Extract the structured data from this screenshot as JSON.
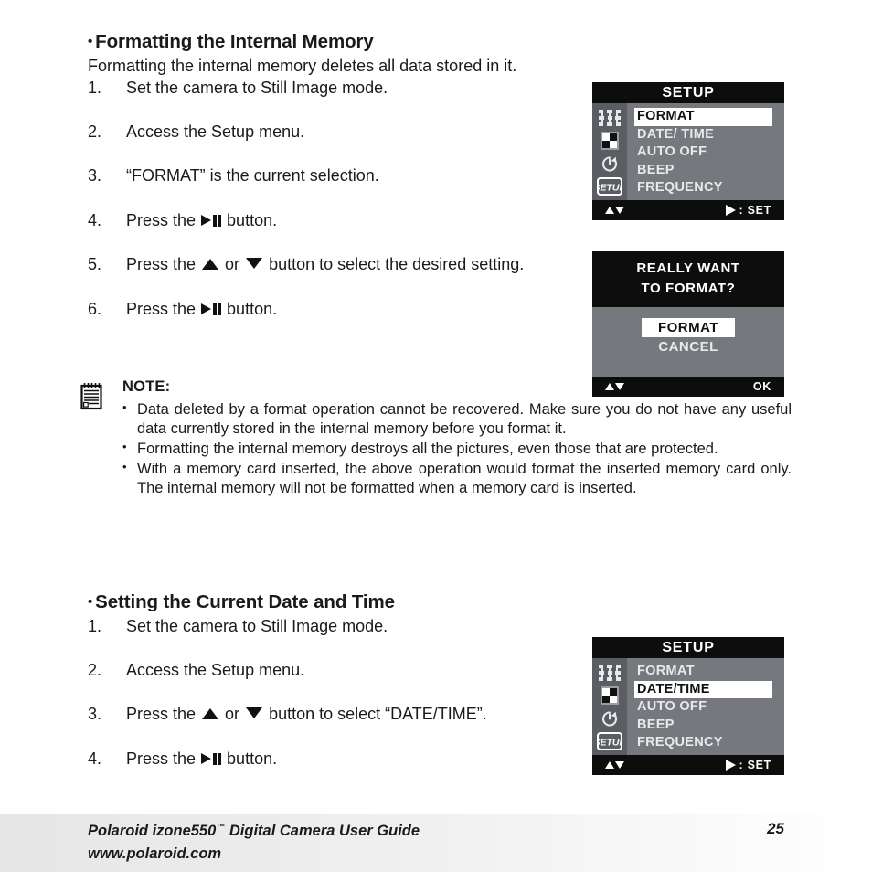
{
  "sections": [
    {
      "heading": "Formatting the Internal Memory",
      "intro": "Formatting the internal memory deletes all data stored in it.",
      "steps": [
        {
          "num": "1.",
          "pre": "Set the camera to Still Image mode.",
          "post": ""
        },
        {
          "num": "2.",
          "pre": "Access the Setup menu.",
          "post": ""
        },
        {
          "num": "3.",
          "pre": "“FORMAT” is the current selection.",
          "post": ""
        },
        {
          "num": "4.",
          "pre": "Press the ",
          "post": " button."
        },
        {
          "num": "5.",
          "pre": "Press the ",
          "post": " button to select the desired setting."
        },
        {
          "num": "6.",
          "pre": "Press the ",
          "post": " button."
        }
      ]
    },
    {
      "heading": "Setting the Current Date and Time",
      "steps": [
        {
          "num": "1.",
          "pre": "Set the camera to Still Image mode.",
          "post": ""
        },
        {
          "num": "2.",
          "pre": "Access the Setup menu.",
          "post": ""
        },
        {
          "num": "3.",
          "pre": "Press the ",
          "post": " button to select “DATE/TIME”."
        },
        {
          "num": "4.",
          "pre": "Press the ",
          "post": " button."
        }
      ]
    }
  ],
  "step5_mid": " or ",
  "note": {
    "heading": "NOTE:",
    "bullet_glyph": "•",
    "items": [
      "Data deleted by a format operation cannot be recovered. Make sure you do not have any useful data currently stored in the internal memory before you format it.",
      "Formatting the internal memory destroys all the pictures, even those that are protected.",
      "With a memory card inserted, the above operation would format the inserted memory card only. The internal memory will not be formatted when a memory card is inserted."
    ]
  },
  "lcd_setup_1": {
    "title": "SETUP",
    "menu": [
      {
        "label": "FORMAT",
        "selected": true
      },
      {
        "label": "DATE/ TIME",
        "selected": false
      },
      {
        "label": "AUTO OFF",
        "selected": false
      },
      {
        "label": "BEEP",
        "selected": false
      },
      {
        "label": "FREQUENCY",
        "selected": false
      }
    ],
    "sidebar_icons": [
      "resolution-icon",
      "quality-icon",
      "self-timer-icon",
      "setup-icon"
    ],
    "setup_icon_label": "SETUP",
    "footer_right": ": SET"
  },
  "lcd_confirm": {
    "line1": "REALLY WANT",
    "line2": "TO FORMAT?",
    "options": [
      {
        "label": "FORMAT",
        "selected": true
      },
      {
        "label": "CANCEL",
        "selected": false
      }
    ],
    "footer_right": "OK"
  },
  "lcd_setup_2": {
    "title": "SETUP",
    "menu": [
      {
        "label": "FORMAT",
        "selected": false
      },
      {
        "label": "DATE/TIME",
        "selected": true
      },
      {
        "label": "AUTO OFF",
        "selected": false
      },
      {
        "label": "BEEP",
        "selected": false
      },
      {
        "label": "FREQUENCY",
        "selected": false
      }
    ],
    "sidebar_icons": [
      "resolution-icon",
      "quality-icon",
      "self-timer-icon",
      "setup-icon"
    ],
    "setup_icon_label": "SETUP",
    "footer_right": ": SET"
  },
  "footer": {
    "line1_a": "Polaroid izone550",
    "line1_tm": "™",
    "line1_b": " Digital Camera User Guide",
    "line2": "www.polaroid.com",
    "page_number": "25"
  }
}
